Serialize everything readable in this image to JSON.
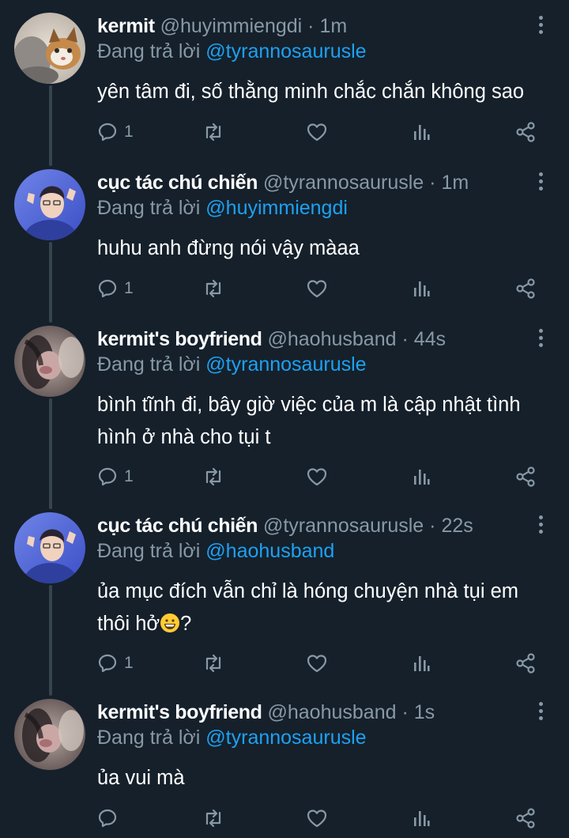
{
  "thread": [
    {
      "name": "kermit",
      "handle": "@huyimmiengdi",
      "separator": "·",
      "time": "1m",
      "reply_prefix": "Đang trả lời",
      "reply_to": "@tyrannosaurusle",
      "text": "yên tâm đi, số thằng minh chắc chắn không sao",
      "reply_count": "1",
      "avatar_icon": "cat-avatar-icon"
    },
    {
      "name": "cục tác chú chiến",
      "handle": "@tyrannosaurusle",
      "separator": "·",
      "time": "1m",
      "reply_prefix": "Đang trả lời",
      "reply_to": "@huyimmiengdi",
      "text": "huhu anh đừng nói vậy màaa",
      "reply_count": "1",
      "avatar_icon": "person-avatar-icon"
    },
    {
      "name": "kermit's boyfriend",
      "handle": "@haohusband",
      "separator": "·",
      "time": "44s",
      "reply_prefix": "Đang trả lời",
      "reply_to": "@tyrannosaurusle",
      "text": "bình tĩnh đi, bây giờ việc của m là cập nhật tình hình ở nhà cho tụi t",
      "reply_count": "1",
      "avatar_icon": "blurry-cat-avatar-icon"
    },
    {
      "name": "cục tác chú chiến",
      "handle": "@tyrannosaurusle",
      "separator": "·",
      "time": "22s",
      "reply_prefix": "Đang trả lời",
      "reply_to": "@haohusband",
      "text": "ủa mục đích vẫn chỉ là hóng chuyện nhà tụi em thôi hở",
      "text_suffix": "?",
      "emoji": "grinning-face-emoji",
      "reply_count": "1",
      "avatar_icon": "person-avatar-icon"
    },
    {
      "name": "kermit's boyfriend",
      "handle": "@haohusband",
      "separator": "·",
      "time": "1s",
      "reply_prefix": "Đang trả lời",
      "reply_to": "@tyrannosaurusle",
      "text": "ủa vui mà",
      "reply_count": "",
      "avatar_icon": "blurry-cat-avatar-icon"
    }
  ],
  "icons": {
    "reply": "reply-icon",
    "retweet": "retweet-icon",
    "like": "heart-icon",
    "analytics": "analytics-icon",
    "share": "share-icon",
    "more": "more-options-icon"
  },
  "colors": {
    "background": "#15202b",
    "secondary_text": "#8899a6",
    "mention": "#1da1f2",
    "thread_line": "#38444d"
  }
}
